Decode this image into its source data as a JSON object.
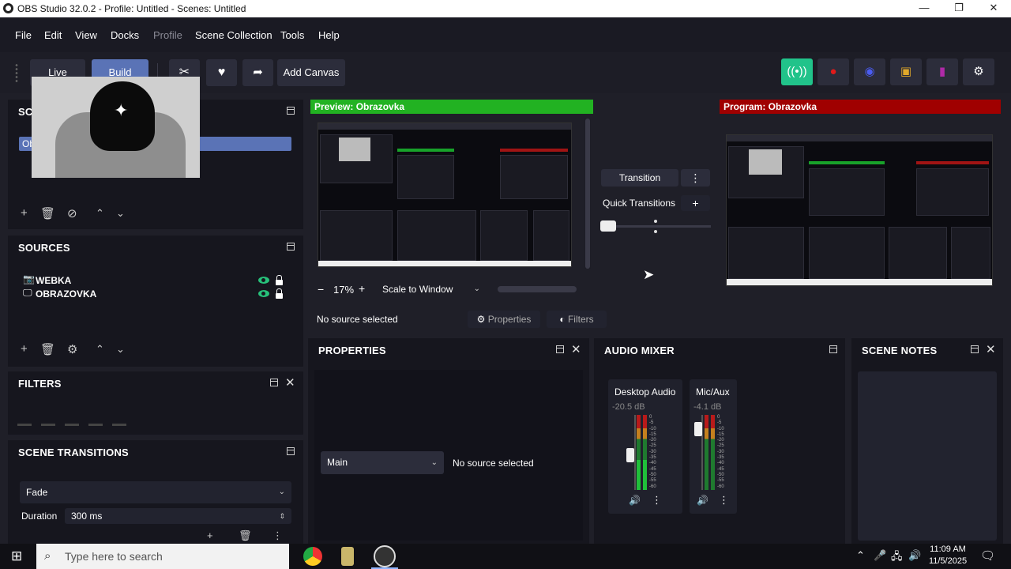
{
  "window": {
    "title": "OBS Studio 32.0.2 - Profile: Untitled - Scenes: Untitled",
    "minimize": "—",
    "restore": "❐",
    "close": "✕"
  },
  "menu": [
    "File",
    "Edit",
    "View",
    "Docks",
    "Profile",
    "Scene Collection",
    "Tools",
    "Help"
  ],
  "toolbar": {
    "live": "Live",
    "build": "Build",
    "add_canvas": "Add Canvas"
  },
  "scenes": {
    "title": "SCENES",
    "items": [
      "Obrazovka"
    ]
  },
  "sources": {
    "title": "SOURCES",
    "items": [
      {
        "name": "WEBKA",
        "icon": "camera-icon"
      },
      {
        "name": "OBRAZOVKA",
        "icon": "monitor-icon"
      }
    ]
  },
  "filters": {
    "title": "FILTERS"
  },
  "scene_transitions": {
    "title": "SCENE TRANSITIONS",
    "selected": "Fade",
    "duration_label": "Duration",
    "duration_value": "300 ms"
  },
  "preview": {
    "title": "Preview: Obrazovka",
    "zoom": "17%",
    "scale_mode": "Scale to Window",
    "minus": "−",
    "plus": "+"
  },
  "program": {
    "title": "Program: Obrazovka"
  },
  "transition": {
    "button": "Transition",
    "quick": "Quick Transitions",
    "plus": "+"
  },
  "source_bar": {
    "status": "No source selected",
    "properties": "Properties",
    "filters": "Filters"
  },
  "properties": {
    "title": "PROPERTIES",
    "canvas": "Main",
    "status": "No source selected"
  },
  "audio_mixer": {
    "title": "AUDIO MIXER",
    "channels": [
      {
        "name": "Desktop Audio",
        "db": "-20.5 dB",
        "level": 0.45
      },
      {
        "name": "Mic/Aux",
        "db": "-4.1 dB",
        "level": 0.88
      }
    ],
    "scale": [
      "0",
      "-5",
      "-10",
      "-15",
      "-20",
      "-25",
      "-30",
      "-35",
      "-40",
      "-45",
      "-50",
      "-55",
      "-60"
    ]
  },
  "scene_notes": {
    "title": "SCENE NOTES"
  },
  "taskbar": {
    "search_placeholder": "Type here to search",
    "time": "11:09 AM",
    "date": "11/5/2025"
  },
  "colors": {
    "preview_header": "#22b222",
    "program_header": "#a00000",
    "stream_button": "#21c38a",
    "selection": "#5a73b6"
  }
}
